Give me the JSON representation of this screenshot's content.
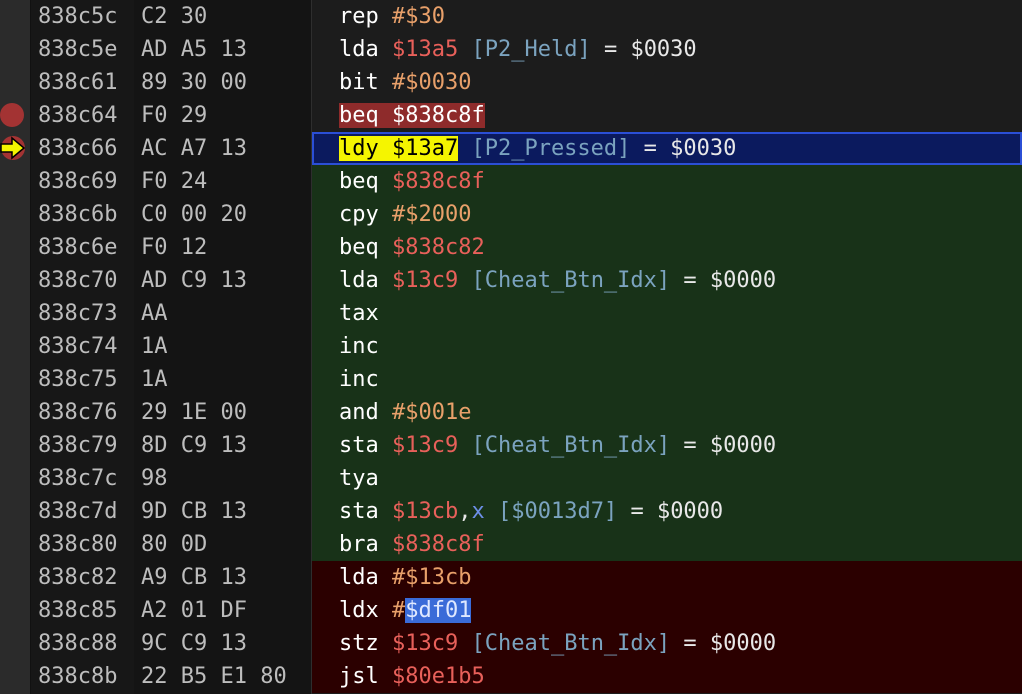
{
  "rows": [
    {
      "addr": "838c5c",
      "bytes": "C2 30",
      "mn": "rep",
      "op": "#$30",
      "lbl": "",
      "val": "",
      "style": "plain",
      "optype": "imm"
    },
    {
      "addr": "838c5e",
      "bytes": "AD A5 13",
      "mn": "lda",
      "op": "$13a5",
      "lbl": "[P2_Held]",
      "val": "= $0030",
      "style": "plain",
      "optype": "addr"
    },
    {
      "addr": "838c61",
      "bytes": "89 30 00",
      "mn": "bit",
      "op": "#$0030",
      "lbl": "",
      "val": "",
      "style": "plain",
      "optype": "imm"
    },
    {
      "addr": "838c64",
      "bytes": "F0 29",
      "mn": "beq",
      "op": "$838c8f",
      "lbl": "",
      "val": "",
      "style": "plain",
      "optype": "addr",
      "breakpoint": true
    },
    {
      "addr": "838c66",
      "bytes": "AC A7 13",
      "mn": "ldy",
      "op": "$13a7",
      "lbl": "[P2_Pressed]",
      "val": "= $0030",
      "style": "current",
      "optype": "addr"
    },
    {
      "addr": "838c69",
      "bytes": "F0 24",
      "mn": "beq",
      "op": "$838c8f",
      "lbl": "",
      "val": "",
      "style": "green",
      "optype": "addr"
    },
    {
      "addr": "838c6b",
      "bytes": "C0 00 20",
      "mn": "cpy",
      "op": "#$2000",
      "lbl": "",
      "val": "",
      "style": "green",
      "optype": "imm"
    },
    {
      "addr": "838c6e",
      "bytes": "F0 12",
      "mn": "beq",
      "op": "$838c82",
      "lbl": "",
      "val": "",
      "style": "green",
      "optype": "addr"
    },
    {
      "addr": "838c70",
      "bytes": "AD C9 13",
      "mn": "lda",
      "op": "$13c9",
      "lbl": "[Cheat_Btn_Idx]",
      "val": "= $0000",
      "style": "green",
      "optype": "addr"
    },
    {
      "addr": "838c73",
      "bytes": "AA",
      "mn": "tax",
      "op": "",
      "lbl": "",
      "val": "",
      "style": "green",
      "optype": "none"
    },
    {
      "addr": "838c74",
      "bytes": "1A",
      "mn": "inc",
      "op": "",
      "lbl": "",
      "val": "",
      "style": "green",
      "optype": "none"
    },
    {
      "addr": "838c75",
      "bytes": "1A",
      "mn": "inc",
      "op": "",
      "lbl": "",
      "val": "",
      "style": "green",
      "optype": "none"
    },
    {
      "addr": "838c76",
      "bytes": "29 1E 00",
      "mn": "and",
      "op": "#$001e",
      "lbl": "",
      "val": "",
      "style": "green",
      "optype": "imm"
    },
    {
      "addr": "838c79",
      "bytes": "8D C9 13",
      "mn": "sta",
      "op": "$13c9",
      "lbl": "[Cheat_Btn_Idx]",
      "val": "= $0000",
      "style": "green",
      "optype": "addr"
    },
    {
      "addr": "838c7c",
      "bytes": "98",
      "mn": "tya",
      "op": "",
      "lbl": "",
      "val": "",
      "style": "green",
      "optype": "none"
    },
    {
      "addr": "838c7d",
      "bytes": "9D CB 13",
      "mn": "sta",
      "op": "$13cb",
      "idx": ",x",
      "lbl": "[$0013d7]",
      "val": "= $0000",
      "style": "green",
      "optype": "addr"
    },
    {
      "addr": "838c80",
      "bytes": "80 0D",
      "mn": "bra",
      "op": "$838c8f",
      "lbl": "",
      "val": "",
      "style": "green",
      "optype": "addr"
    },
    {
      "addr": "838c82",
      "bytes": "A9 CB 13",
      "mn": "lda",
      "op": "#$13cb",
      "lbl": "",
      "val": "",
      "style": "red",
      "optype": "imm"
    },
    {
      "addr": "838c85",
      "bytes": "A2 01 DF",
      "mn": "ldx",
      "op": "#",
      "op2": "$df01",
      "lbl": "",
      "val": "",
      "style": "red",
      "optype": "immsel"
    },
    {
      "addr": "838c88",
      "bytes": "9C C9 13",
      "mn": "stz",
      "op": "$13c9",
      "lbl": "[Cheat_Btn_Idx]",
      "val": "= $0000",
      "style": "red",
      "optype": "addr"
    },
    {
      "addr": "838c8b",
      "bytes": "22 B5 E1 80",
      "mn": "jsl",
      "op": "$80e1b5",
      "lbl": "",
      "val": "",
      "style": "red",
      "optype": "addr"
    }
  ]
}
